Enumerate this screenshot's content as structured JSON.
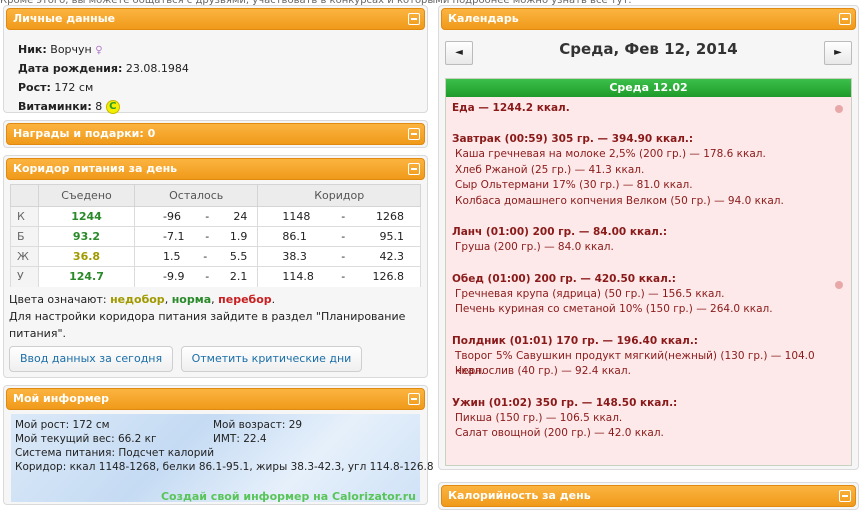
{
  "topline": "Кроме этого, вы можете общаться с друзьями, участвовать в конкурсах и которыми подробнее можно узнать все тут.",
  "personal": {
    "title": "Личные данные",
    "nick_label": "Ник:",
    "nick": "Ворчун",
    "birth_label": "Дата рождения:",
    "birth": "23.08.1984",
    "height_label": "Рост:",
    "height": "172 см",
    "vitamins_label": "Витаминки:",
    "vitamins": "8",
    "vitamin_icon": "С"
  },
  "awards": {
    "title": "Награды и подарки: 0"
  },
  "corridor": {
    "title": "Коридор питания за день",
    "headers": [
      "",
      "Съедено",
      "Осталось",
      "Коридор"
    ],
    "rows": [
      {
        "k": "К",
        "eaten": "1244",
        "left_min": "-96",
        "left_max": "24",
        "corr_min": "1148",
        "corr_max": "1268"
      },
      {
        "k": "Б",
        "eaten": "93.2",
        "left_min": "-7.1",
        "left_max": "1.9",
        "corr_min": "86.1",
        "corr_max": "95.1"
      },
      {
        "k": "Ж",
        "eaten": "36.8",
        "left_min": "1.5",
        "left_max": "5.5",
        "corr_min": "38.3",
        "corr_max": "42.3"
      },
      {
        "k": "У",
        "eaten": "124.7",
        "left_min": "-9.9",
        "left_max": "2.1",
        "corr_min": "114.8",
        "corr_max": "126.8"
      }
    ],
    "sep": "-",
    "legend_prefix": "Цвета означают:",
    "legend_under": "недобор",
    "legend_norm": "норма",
    "legend_over": "перебор",
    "settings_text": "Для настройки коридора питания зайдите в раздел \"Планирование питания\".",
    "btn_today": "Ввод данных за сегодня",
    "btn_critical": "Отметить критические дни",
    "colors": {
      "under": "#a09a00",
      "norm": "#2a8a2a",
      "over": "#c82020"
    }
  },
  "informer": {
    "title": "Мой информер",
    "height": "Мой рост: 172 см",
    "age": "Мой возраст: 29",
    "weight": "Мой текущий вес: 66.2 кг",
    "bmi": "ИМТ: 22.4",
    "system": "Система питания: Подсчет калорий",
    "corridor": "Коридор: ккал 1148-1268, белки 86.1-95.1, жиры 38.3-42.3, угл 114.8-126.8",
    "link": "Создай свой информер на Calorizator.ru"
  },
  "calendar": {
    "title": "Календарь",
    "prev": "◄",
    "next": "►",
    "date": "Среда, Фев 12, 2014",
    "day_label": "Среда 12.02",
    "total": "Еда — 1244.2 ккал.",
    "meals": [
      {
        "head": "Завтрак (00:59) 305 гр. — 394.90 ккал.:",
        "items": [
          "Каша гречневая на молоке 2,5% (200 гр.) — 178.6 ккал.",
          "Хлеб Ржаной (25 гр.) — 41.3 ккал.",
          "Сыр Ольтермани 17% (30 гр.) — 81.0 ккал.",
          "Колбаса домашнего копчения Велком (50 гр.) — 94.0 ккал."
        ]
      },
      {
        "head": "Ланч (01:00) 200 гр. — 84.00 ккал.:",
        "items": [
          "Груша (200 гр.) — 84.0 ккал."
        ]
      },
      {
        "head": "Обед (01:00) 200 гр. — 420.50 ккал.:",
        "items": [
          "Гречневая крупа (ядрица) (50 гр.) — 156.5 ккал.",
          "Печень куриная со сметаной 10% (150 гр.) — 264.0 ккал."
        ]
      },
      {
        "head": "Полдник (01:01) 170 гр. — 196.40 ккал.:",
        "items": [
          "Творог 5% Савушкин продукт мягкий(нежный) (130 гр.) — 104.0 ккал.",
          "Чернослив (40 гр.) — 92.4 ккал."
        ]
      },
      {
        "head": "Ужин (01:02) 350 гр. — 148.50 ккал.:",
        "items": [
          "Пикша (150 гр.) — 106.5 ккал.",
          "Салат овощной (200 гр.) — 42.0 ккал."
        ]
      }
    ]
  },
  "calories": {
    "title": "Калорийность за день"
  }
}
